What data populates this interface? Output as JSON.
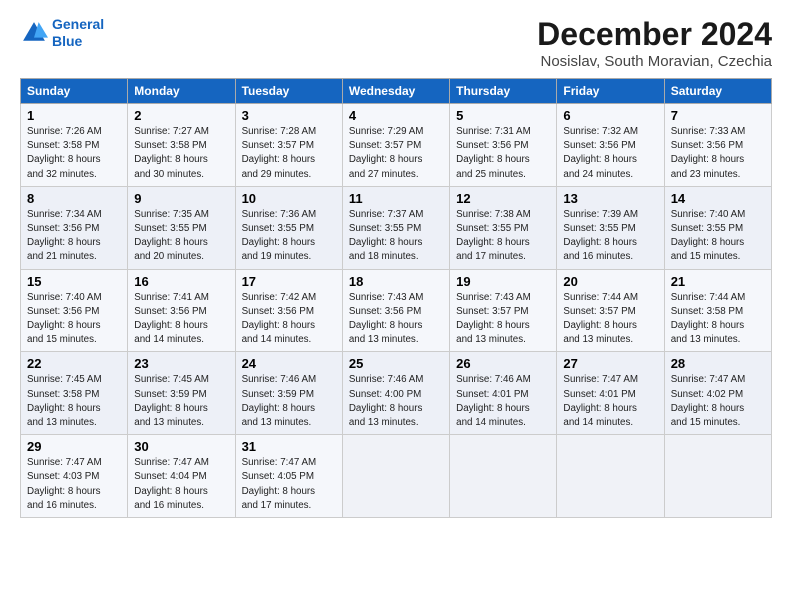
{
  "logo": {
    "line1": "General",
    "line2": "Blue"
  },
  "title": "December 2024",
  "subtitle": "Nosislav, South Moravian, Czechia",
  "headers": [
    "Sunday",
    "Monday",
    "Tuesday",
    "Wednesday",
    "Thursday",
    "Friday",
    "Saturday"
  ],
  "weeks": [
    [
      {
        "day": "1",
        "info": "Sunrise: 7:26 AM\nSunset: 3:58 PM\nDaylight: 8 hours\nand 32 minutes."
      },
      {
        "day": "2",
        "info": "Sunrise: 7:27 AM\nSunset: 3:58 PM\nDaylight: 8 hours\nand 30 minutes."
      },
      {
        "day": "3",
        "info": "Sunrise: 7:28 AM\nSunset: 3:57 PM\nDaylight: 8 hours\nand 29 minutes."
      },
      {
        "day": "4",
        "info": "Sunrise: 7:29 AM\nSunset: 3:57 PM\nDaylight: 8 hours\nand 27 minutes."
      },
      {
        "day": "5",
        "info": "Sunrise: 7:31 AM\nSunset: 3:56 PM\nDaylight: 8 hours\nand 25 minutes."
      },
      {
        "day": "6",
        "info": "Sunrise: 7:32 AM\nSunset: 3:56 PM\nDaylight: 8 hours\nand 24 minutes."
      },
      {
        "day": "7",
        "info": "Sunrise: 7:33 AM\nSunset: 3:56 PM\nDaylight: 8 hours\nand 23 minutes."
      }
    ],
    [
      {
        "day": "8",
        "info": "Sunrise: 7:34 AM\nSunset: 3:56 PM\nDaylight: 8 hours\nand 21 minutes."
      },
      {
        "day": "9",
        "info": "Sunrise: 7:35 AM\nSunset: 3:55 PM\nDaylight: 8 hours\nand 20 minutes."
      },
      {
        "day": "10",
        "info": "Sunrise: 7:36 AM\nSunset: 3:55 PM\nDaylight: 8 hours\nand 19 minutes."
      },
      {
        "day": "11",
        "info": "Sunrise: 7:37 AM\nSunset: 3:55 PM\nDaylight: 8 hours\nand 18 minutes."
      },
      {
        "day": "12",
        "info": "Sunrise: 7:38 AM\nSunset: 3:55 PM\nDaylight: 8 hours\nand 17 minutes."
      },
      {
        "day": "13",
        "info": "Sunrise: 7:39 AM\nSunset: 3:55 PM\nDaylight: 8 hours\nand 16 minutes."
      },
      {
        "day": "14",
        "info": "Sunrise: 7:40 AM\nSunset: 3:55 PM\nDaylight: 8 hours\nand 15 minutes."
      }
    ],
    [
      {
        "day": "15",
        "info": "Sunrise: 7:40 AM\nSunset: 3:56 PM\nDaylight: 8 hours\nand 15 minutes."
      },
      {
        "day": "16",
        "info": "Sunrise: 7:41 AM\nSunset: 3:56 PM\nDaylight: 8 hours\nand 14 minutes."
      },
      {
        "day": "17",
        "info": "Sunrise: 7:42 AM\nSunset: 3:56 PM\nDaylight: 8 hours\nand 14 minutes."
      },
      {
        "day": "18",
        "info": "Sunrise: 7:43 AM\nSunset: 3:56 PM\nDaylight: 8 hours\nand 13 minutes."
      },
      {
        "day": "19",
        "info": "Sunrise: 7:43 AM\nSunset: 3:57 PM\nDaylight: 8 hours\nand 13 minutes."
      },
      {
        "day": "20",
        "info": "Sunrise: 7:44 AM\nSunset: 3:57 PM\nDaylight: 8 hours\nand 13 minutes."
      },
      {
        "day": "21",
        "info": "Sunrise: 7:44 AM\nSunset: 3:58 PM\nDaylight: 8 hours\nand 13 minutes."
      }
    ],
    [
      {
        "day": "22",
        "info": "Sunrise: 7:45 AM\nSunset: 3:58 PM\nDaylight: 8 hours\nand 13 minutes."
      },
      {
        "day": "23",
        "info": "Sunrise: 7:45 AM\nSunset: 3:59 PM\nDaylight: 8 hours\nand 13 minutes."
      },
      {
        "day": "24",
        "info": "Sunrise: 7:46 AM\nSunset: 3:59 PM\nDaylight: 8 hours\nand 13 minutes."
      },
      {
        "day": "25",
        "info": "Sunrise: 7:46 AM\nSunset: 4:00 PM\nDaylight: 8 hours\nand 13 minutes."
      },
      {
        "day": "26",
        "info": "Sunrise: 7:46 AM\nSunset: 4:01 PM\nDaylight: 8 hours\nand 14 minutes."
      },
      {
        "day": "27",
        "info": "Sunrise: 7:47 AM\nSunset: 4:01 PM\nDaylight: 8 hours\nand 14 minutes."
      },
      {
        "day": "28",
        "info": "Sunrise: 7:47 AM\nSunset: 4:02 PM\nDaylight: 8 hours\nand 15 minutes."
      }
    ],
    [
      {
        "day": "29",
        "info": "Sunrise: 7:47 AM\nSunset: 4:03 PM\nDaylight: 8 hours\nand 16 minutes."
      },
      {
        "day": "30",
        "info": "Sunrise: 7:47 AM\nSunset: 4:04 PM\nDaylight: 8 hours\nand 16 minutes."
      },
      {
        "day": "31",
        "info": "Sunrise: 7:47 AM\nSunset: 4:05 PM\nDaylight: 8 hours\nand 17 minutes."
      },
      {
        "day": "",
        "info": ""
      },
      {
        "day": "",
        "info": ""
      },
      {
        "day": "",
        "info": ""
      },
      {
        "day": "",
        "info": ""
      }
    ]
  ]
}
